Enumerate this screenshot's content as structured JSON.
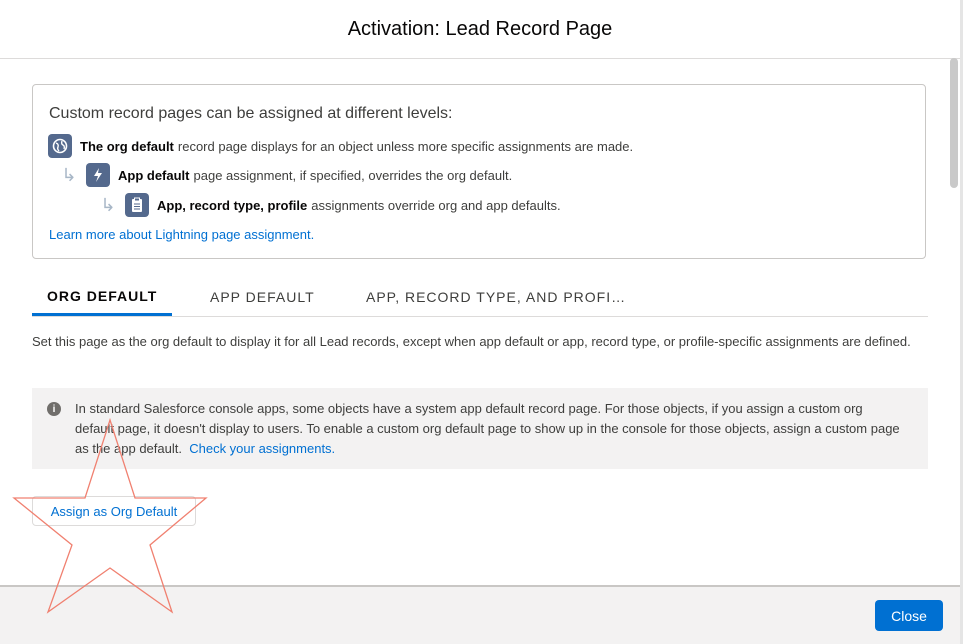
{
  "header": {
    "title": "Activation: Lead Record Page"
  },
  "info": {
    "heading": "Custom record pages can be assigned at different levels:",
    "levels": [
      {
        "bold": "The org default",
        "text": "record page displays for an object unless more specific assignments are made.",
        "icon": "globe-icon"
      },
      {
        "bold": "App default",
        "text": "page assignment, if specified, overrides the org default.",
        "icon": "lightning-icon"
      },
      {
        "bold": "App, record type, profile",
        "text": "assignments override org and app defaults.",
        "icon": "clipboard-icon"
      }
    ],
    "learn_link": "Learn more about Lightning page assignment."
  },
  "tabs": [
    {
      "label": "ORG DEFAULT",
      "active": true
    },
    {
      "label": "APP DEFAULT",
      "active": false
    },
    {
      "label": "APP, RECORD TYPE, AND PROFI…",
      "active": false
    }
  ],
  "description": "Set this page as the org default to display it for all Lead records, except when app default or app, record type, or profile-specific assignments are defined.",
  "notice": {
    "icon": "info-icon",
    "text": "In standard Salesforce console apps, some objects have a system app default record page. For those objects, if you assign a custom org default page, it doesn't display to users. To enable a custom org default page to show up in the console for those objects, assign a custom page as the app default.",
    "link": "Check your assignments."
  },
  "assign_button": "Assign as Org Default",
  "footer": {
    "close_label": "Close"
  },
  "colors": {
    "brand": "#0070d2",
    "icon_bg": "#54698d",
    "annotation": "#f08070"
  }
}
